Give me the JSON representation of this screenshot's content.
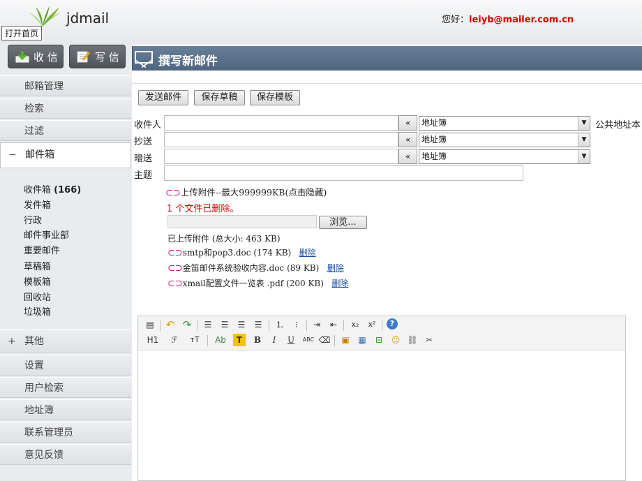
{
  "header": {
    "app_name": "jdmail",
    "tooltip": "打开首页",
    "greeting_prefix": "您好：",
    "user_email": "leiyb@mailer.com.cn"
  },
  "top_buttons": {
    "receive": "收 信",
    "compose": "写 信"
  },
  "sidebar": {
    "nav_top": [
      "邮箱管理",
      "检索",
      "过滤"
    ],
    "mailbox_toggle": "−",
    "mailbox_label": "邮件箱",
    "folders": [
      "收件箱",
      "发件箱",
      "行政",
      "邮件事业部",
      "重要邮件",
      "草稿箱",
      "模板箱",
      "回收站",
      "垃圾箱"
    ],
    "inbox_count": "(166)",
    "other_toggle": "+",
    "other_label": "其他",
    "nav_bottom": [
      "设置",
      "用户检索",
      "地址簿",
      "联系管理员",
      "意见反馈"
    ]
  },
  "compose": {
    "title": "撰写新邮件",
    "buttons": [
      "发送邮件",
      "保存草稿",
      "保存模板"
    ],
    "fields": {
      "to_label": "收件人",
      "cc_label": "抄送",
      "bcc_label": "暗送",
      "subject_label": "主题",
      "to_value": "",
      "cc_value": "",
      "bcc_value": "",
      "subject_value": ""
    },
    "arrow_button": "«",
    "address_book_select": "地址簿",
    "public_address_book": "公共地址本",
    "attachments": {
      "upload_toggle": "上传附件--最大999999KB(点击隐藏)",
      "deleted_msg": "1 个文件已删除。",
      "browse_button": "浏览...",
      "uploaded_header": "已上传附件 (总大小: 463 KB)",
      "delete_label": "删除",
      "files": [
        {
          "name": "smtp和pop3.doc",
          "size": "(174 KB)"
        },
        {
          "name": "金笛邮件系统验收内容.doc",
          "size": "(89 KB)"
        },
        {
          "name": "xmail配置文件一览表 .pdf",
          "size": "(200 KB)"
        }
      ]
    },
    "editor_toolbar": {
      "heading": "H1",
      "font": "ℱ",
      "size": "тT",
      "text_color": "Ab",
      "highlight": "T",
      "bold": "B",
      "italic": "I",
      "underline": "U",
      "strike": "ABC",
      "subscript": "x₂",
      "superscript": "x²",
      "help": "?"
    }
  },
  "colors": {
    "title_bar": "#5a718c",
    "accent_red": "#d40000",
    "link_blue": "#1a4fa0",
    "attachment_magenta": "#c2188a"
  }
}
